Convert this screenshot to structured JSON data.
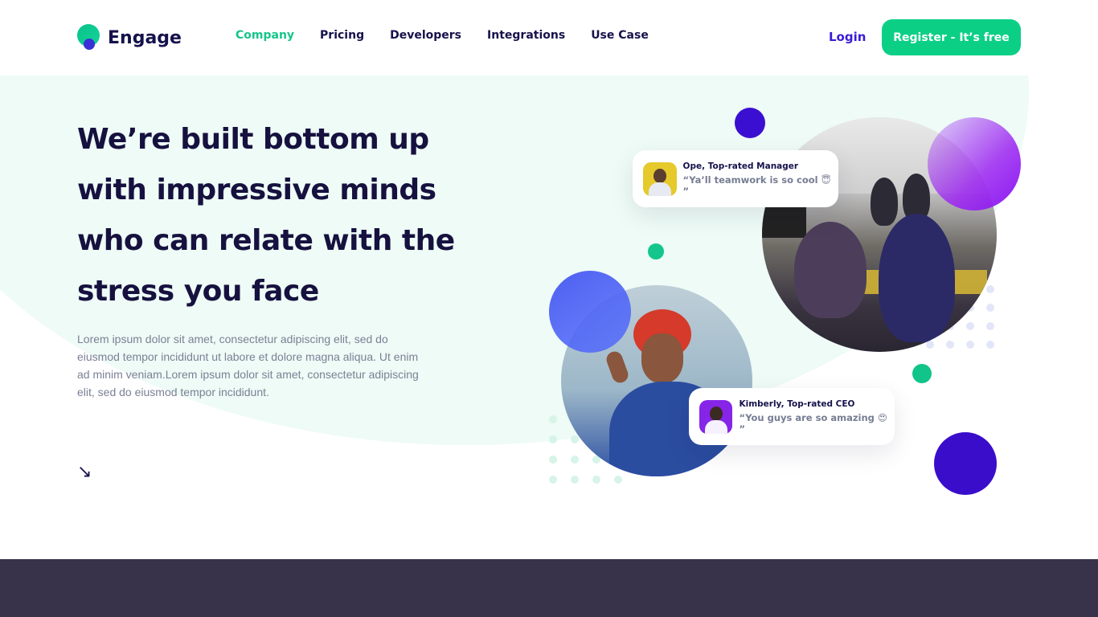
{
  "header": {
    "brand": "Engage",
    "nav": {
      "company": "Company",
      "pricing": "Pricing",
      "developers": "Developers",
      "integrations": "Integrations",
      "use_case": "Use Case"
    },
    "login": "Login",
    "register": "Register - It’s free",
    "active_color": "#16c58a",
    "accent_green": "#0ccf86",
    "accent_purple": "#3a1bd6"
  },
  "hero": {
    "headline": "We’re built bottom up with impressive minds who can relate with the stress you face",
    "paragraph": "Lorem ipsum dolor sit amet, consectetur adipiscing elit, sed do eiusmod tempor incididunt ut labore et dolore magna aliqua. Ut enim ad minim veniam.Lorem ipsum dolor sit amet, consectetur adipiscing elit, sed do eiusmod tempor incididunt.",
    "arrow": "↘"
  },
  "testimonials": {
    "ope": {
      "name": "Ope, Top-rated Manager",
      "quote": "“Ya’ll teamwork is so cool 😇 ”"
    },
    "kimberly": {
      "name": "Kimberly, Top-rated CEO",
      "quote": "“You guys are so amazing 😍 ”"
    }
  },
  "icons": {
    "arrow": "arrow-down-right-icon",
    "logo": "engage-logo-icon"
  },
  "colors": {
    "footer_band": "#38324b",
    "deep_purple": "#3a0dcb",
    "green": "#11c48a"
  }
}
